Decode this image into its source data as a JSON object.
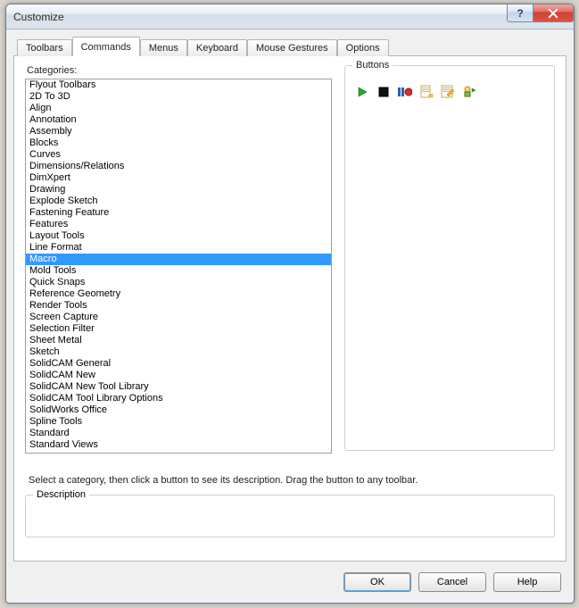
{
  "window": {
    "title": "Customize"
  },
  "tabs": {
    "toolbars": "Toolbars",
    "commands": "Commands",
    "menus": "Menus",
    "keyboard": "Keyboard",
    "mouse": "Mouse Gestures",
    "options": "Options"
  },
  "labels": {
    "categories": "Categories:",
    "buttons": "Buttons",
    "description": "Description",
    "hint": "Select a category, then click a button to see its description. Drag the button to any toolbar."
  },
  "categories": [
    "Flyout Toolbars",
    "2D To 3D",
    "Align",
    "Annotation",
    "Assembly",
    "Blocks",
    "Curves",
    "Dimensions/Relations",
    "DimXpert",
    "Drawing",
    "Explode Sketch",
    "Fastening Feature",
    "Features",
    "Layout Tools",
    "Line Format",
    "Macro",
    "Mold Tools",
    "Quick Snaps",
    "Reference Geometry",
    "Render Tools",
    "Screen Capture",
    "Selection Filter",
    "Sheet Metal",
    "Sketch",
    "SolidCAM General",
    "SolidCAM New",
    "SolidCAM New Tool Library",
    "SolidCAM Tool Library Options",
    "SolidWorks Office",
    "Spline Tools",
    "Standard",
    "Standard Views"
  ],
  "selected_category": "Macro",
  "tool_icons": [
    "run",
    "stop",
    "pause-record",
    "new-doc",
    "edit-doc",
    "assign"
  ],
  "footer": {
    "ok": "OK",
    "cancel": "Cancel",
    "help": "Help"
  }
}
